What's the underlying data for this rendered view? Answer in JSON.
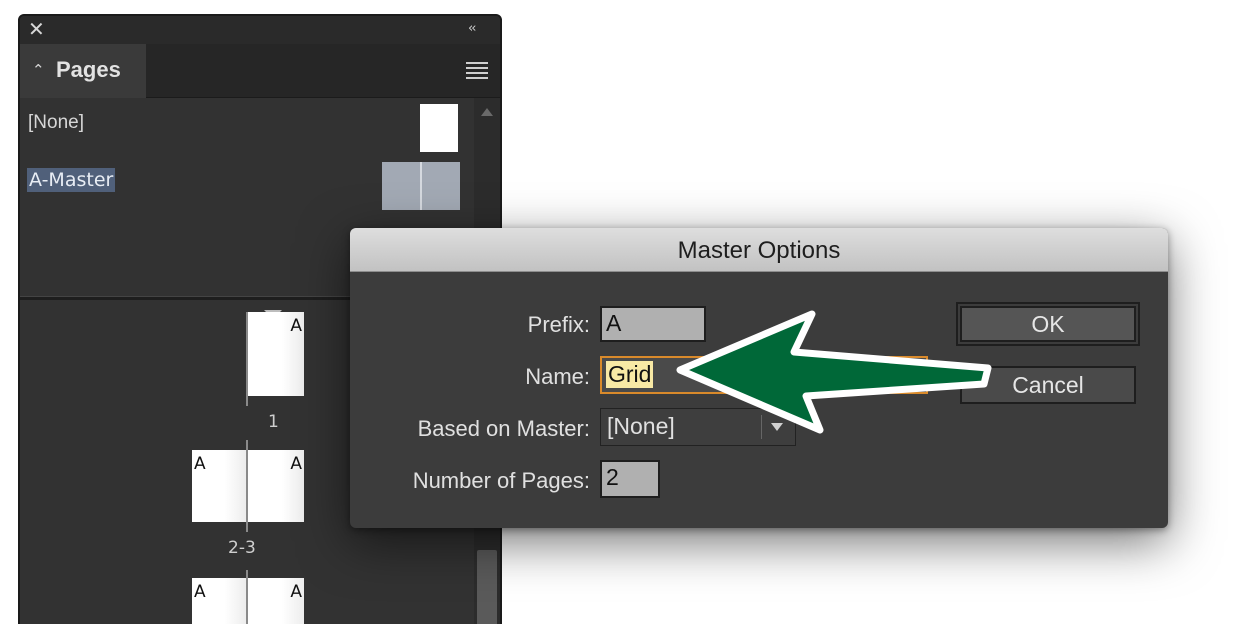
{
  "pages_panel": {
    "tab_label": "Pages",
    "masters": [
      {
        "label": "[None]"
      },
      {
        "label": "A-Master"
      }
    ],
    "pages": [
      {
        "number": "1",
        "prefix": "A"
      },
      {
        "number": "2-3",
        "prefix_left": "A",
        "prefix_right": "A"
      },
      {
        "prefix_left": "A",
        "prefix_right": "A"
      }
    ]
  },
  "dialog": {
    "title": "Master Options",
    "prefix_label": "Prefix:",
    "prefix_value": "A",
    "name_label": "Name:",
    "name_value": "Grid",
    "based_on_label": "Based on Master:",
    "based_on_value": "[None]",
    "num_pages_label": "Number of Pages:",
    "num_pages_value": "2",
    "ok_label": "OK",
    "cancel_label": "Cancel"
  },
  "annotation": {
    "arrow_color": "#006838",
    "arrow_outline": "#ffffff"
  }
}
